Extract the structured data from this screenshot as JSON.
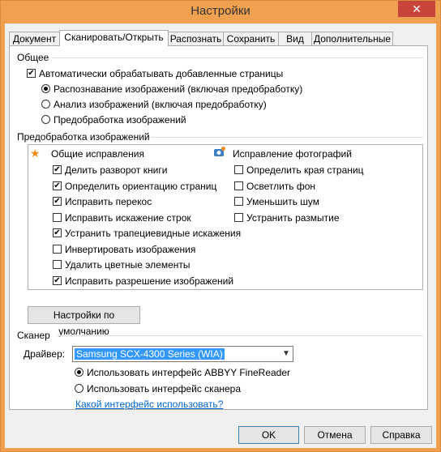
{
  "window": {
    "title": "Настройки",
    "close_glyph": "✕"
  },
  "tabs": [
    {
      "label": "Документ"
    },
    {
      "label": "Сканировать/Открыть"
    },
    {
      "label": "Распознать"
    },
    {
      "label": "Сохранить"
    },
    {
      "label": "Вид"
    },
    {
      "label": "Дополнительные"
    }
  ],
  "general": {
    "title": "Общее",
    "auto_process": {
      "label": "Автоматически обрабатывать добавленные страницы",
      "checked": true
    },
    "options": [
      {
        "label": "Распознавание изображений (включая предобработку)",
        "selected": true
      },
      {
        "label": "Анализ изображений (включая предобработку)",
        "selected": false
      },
      {
        "label": "Предобработка изображений",
        "selected": false
      }
    ]
  },
  "preprocess": {
    "title": "Предобработка изображений",
    "common_title": "Общие исправления",
    "common": [
      {
        "label": "Делить разворот книги",
        "checked": true
      },
      {
        "label": "Определить ориентацию страниц",
        "checked": true
      },
      {
        "label": "Исправить перекос",
        "checked": true
      },
      {
        "label": "Исправить искажение строк",
        "checked": false
      },
      {
        "label": "Устранить трапециевидные искажения",
        "checked": true
      },
      {
        "label": "Инвертировать изображения",
        "checked": false
      },
      {
        "label": "Удалить цветные элементы",
        "checked": false
      },
      {
        "label": "Исправить разрешение изображений",
        "checked": true
      }
    ],
    "photo_title": "Исправление фотографий",
    "photo": [
      {
        "label": "Определить края страниц",
        "checked": false
      },
      {
        "label": "Осветлить фон",
        "checked": false
      },
      {
        "label": "Уменьшить шум",
        "checked": false
      },
      {
        "label": "Устранить размытие",
        "checked": false
      }
    ],
    "defaults_button": "Настройки по умолчанию"
  },
  "scanner": {
    "title": "Сканер",
    "driver_label": "Драйвер:",
    "driver_value": "Samsung SCX-4300 Series (WIA)",
    "interfaces": [
      {
        "label": "Использовать интерфейс ABBYY FineReader",
        "selected": true
      },
      {
        "label": "Использовать интерфейс сканера",
        "selected": false
      }
    ],
    "help_link": "Какой интерфейс использовать?"
  },
  "buttons": {
    "ok": "OK",
    "cancel": "Отмена",
    "help": "Справка"
  },
  "check_glyph": "✔",
  "colors": {
    "accent": "#f0a14f",
    "link": "#0066cc",
    "close": "#c7453a"
  }
}
